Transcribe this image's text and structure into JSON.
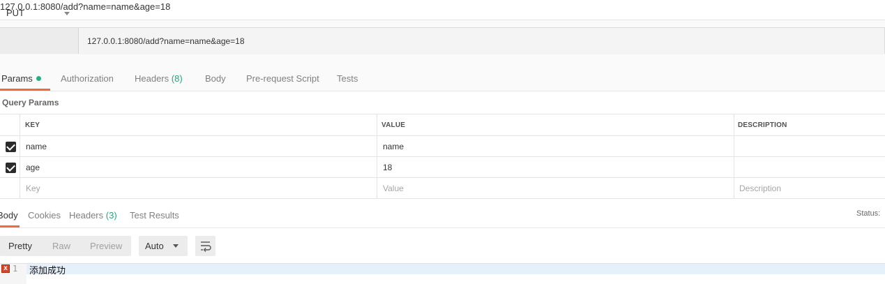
{
  "request": {
    "title": "127.0.0.1:8080/add?name=name&age=18",
    "method": "PUT",
    "url": "127.0.0.1:8080/add?name=name&age=18"
  },
  "request_tabs": [
    {
      "label": "Params",
      "count": ""
    },
    {
      "label": "Authorization",
      "count": ""
    },
    {
      "label": "Headers",
      "count": "(8)"
    },
    {
      "label": "Body",
      "count": ""
    },
    {
      "label": "Pre-request Script",
      "count": ""
    },
    {
      "label": "Tests",
      "count": ""
    }
  ],
  "query_params": {
    "label": "Query Params",
    "headers": {
      "key": "KEY",
      "value": "VALUE",
      "description": "DESCRIPTION"
    },
    "rows": [
      {
        "checked": true,
        "key": "name",
        "value": "name",
        "description": ""
      },
      {
        "checked": true,
        "key": "age",
        "value": "18",
        "description": ""
      }
    ],
    "placeholder": {
      "key": "Key",
      "value": "Value",
      "description": "Description"
    }
  },
  "response_tabs": [
    {
      "label": "Body",
      "count": ""
    },
    {
      "label": "Cookies",
      "count": ""
    },
    {
      "label": "Headers",
      "count": "(3)"
    },
    {
      "label": "Test Results",
      "count": ""
    }
  ],
  "status": {
    "label": "Status: "
  },
  "view_modes": [
    "Pretty",
    "Raw",
    "Preview"
  ],
  "format": "Auto",
  "body": {
    "line_number": "1",
    "error_icon": "x",
    "content": "添加成功"
  },
  "colors": {
    "accent_orange": "#f26b3a",
    "accent_green": "#26b080"
  }
}
